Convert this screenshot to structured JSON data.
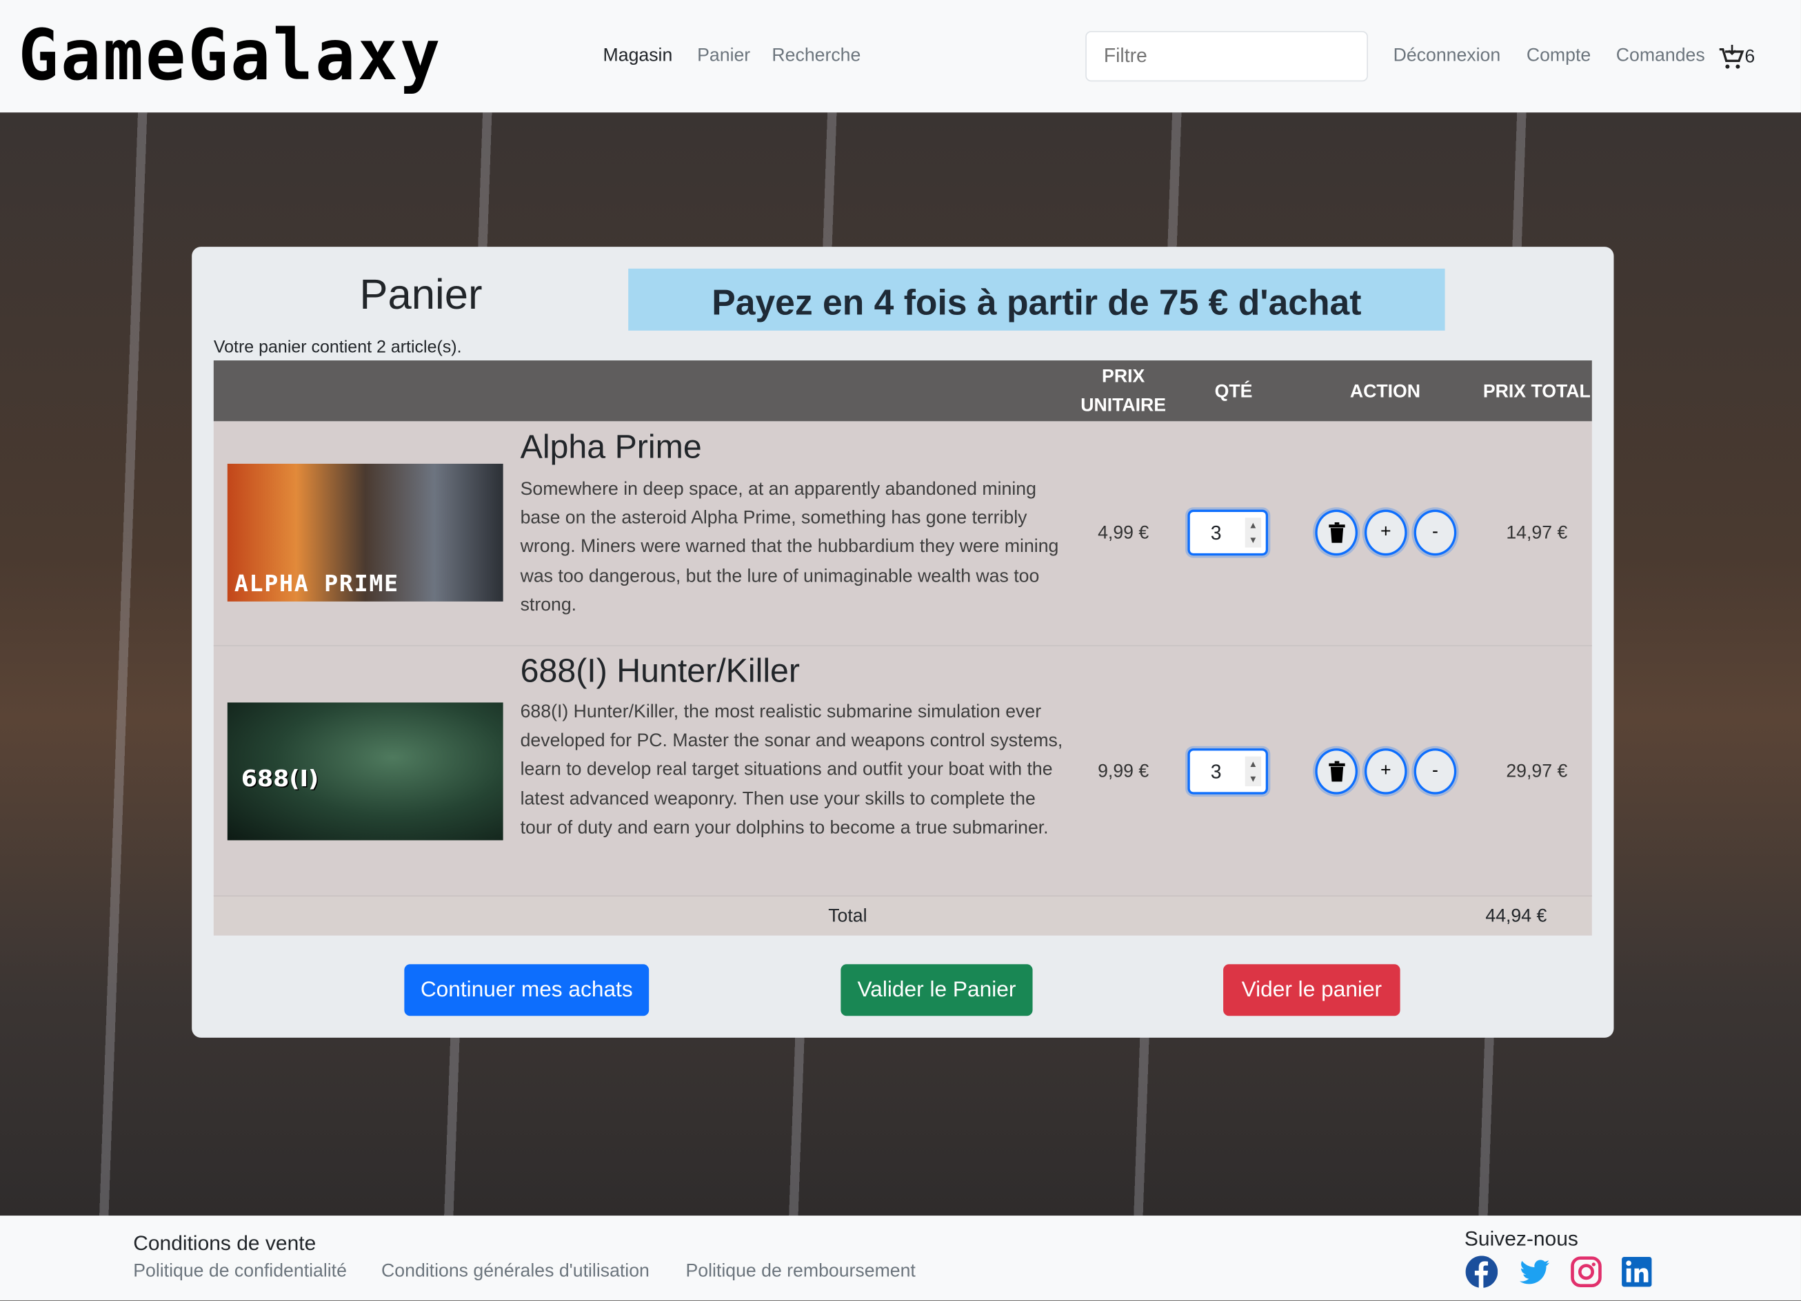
{
  "header": {
    "logo": "GameGalaxy",
    "nav": [
      "Magasin",
      "Panier",
      "Recherche"
    ],
    "filter_placeholder": "Filtre",
    "right_nav": [
      "Déconnexion",
      "Compte",
      "Comandes"
    ],
    "cart_count": "6"
  },
  "cart": {
    "title": "Panier",
    "banner": "Payez en 4 fois à partir de 75 € d'achat",
    "count_text": "Votre panier contient 2 article(s).",
    "columns": {
      "unit_price": [
        "PRIX",
        "UNITAIRE"
      ],
      "qty": "QTÉ",
      "action": "ACTION",
      "total": "PRIX TOTAL"
    },
    "items": [
      {
        "name": "Alpha Prime",
        "image_label": "ALPHA PRIME",
        "description": "Somewhere in deep space, at an apparently abandoned mining base on the asteroid Alpha Prime, something has gone terribly wrong. Miners were warned that the hubbardium they were mining was too dangerous, but the lure of unimaginable wealth was too strong.",
        "unit_price": "4,99 €",
        "qty": "3",
        "total": "14,97 €"
      },
      {
        "name": "688(I) Hunter/Killer",
        "image_label": "688(I)",
        "description": "688(I) Hunter/Killer, the most realistic submarine simulation ever developed for PC. Master the sonar and weapons control systems, learn to develop real target situations and outfit your boat with the latest advanced weaponry. Then use your skills to complete the tour of duty and earn your dolphins to become a true submariner.",
        "unit_price": "9,99 €",
        "qty": "3",
        "total": "29,97 €"
      }
    ],
    "action_labels": {
      "plus": "+",
      "minus": "-"
    },
    "total_label": "Total",
    "total_value": "44,94 €",
    "buttons": {
      "continue": "Continuer mes achats",
      "validate": "Valider le Panier",
      "empty": "Vider le panier"
    },
    "colors": {
      "primary": "#0d6efd",
      "success": "#198754",
      "danger": "#dc3545"
    }
  },
  "footer": {
    "conditions_title": "Conditions de vente",
    "links": [
      "Politique de confidentialité",
      "Conditions générales d'utilisation",
      "Politique de remboursement"
    ],
    "follow": "Suivez-nous",
    "socials": [
      "facebook-icon",
      "twitter-icon",
      "instagram-icon",
      "linkedin-icon"
    ]
  }
}
